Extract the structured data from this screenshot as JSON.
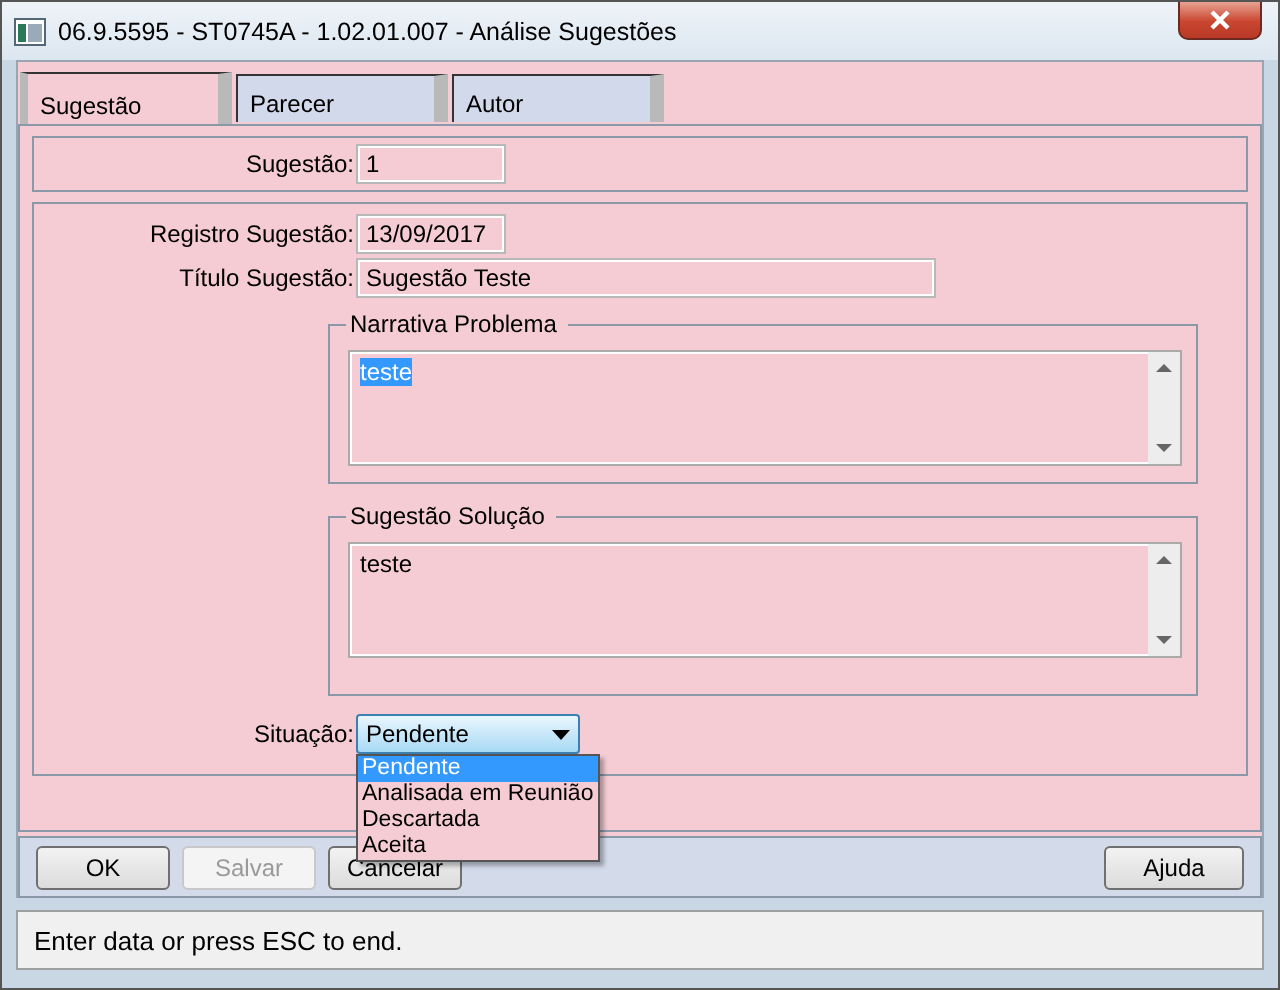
{
  "window": {
    "title": "06.9.5595 - ST0745A - 1.02.01.007 - Análise Sugestões"
  },
  "tabs": [
    {
      "label": "Sugestão",
      "selected": true
    },
    {
      "label": "Parecer",
      "selected": false
    },
    {
      "label": "Autor",
      "selected": false
    }
  ],
  "header": {
    "label": "Sugestão:",
    "value": "1"
  },
  "fields": [
    {
      "label": "Registro Sugestão:",
      "value": "13/09/2017",
      "kind": "short"
    },
    {
      "label": "Título Sugestão:",
      "value": "Sugestão Teste",
      "kind": "long"
    }
  ],
  "text_groups": [
    {
      "title": "Narrativa Problema",
      "value": "teste",
      "text_selected": true
    },
    {
      "title": "Sugestão Solução",
      "value": "teste",
      "text_selected": false
    }
  ],
  "situacao": {
    "label": "Situação:",
    "value": "Pendente",
    "expanded": true,
    "options": [
      {
        "label": "Pendente",
        "selected": true
      },
      {
        "label": "Analisada em Reunião",
        "selected": false
      },
      {
        "label": "Descartada",
        "selected": false
      },
      {
        "label": "Aceita",
        "selected": false
      }
    ]
  },
  "buttons": [
    {
      "label": "OK",
      "disabled": false
    },
    {
      "label": "Salvar",
      "disabled": true
    },
    {
      "label": "Cancelar",
      "disabled": false
    }
  ],
  "help_button": {
    "label": "Ajuda"
  },
  "status_bar": "Enter data or press ESC to end."
}
